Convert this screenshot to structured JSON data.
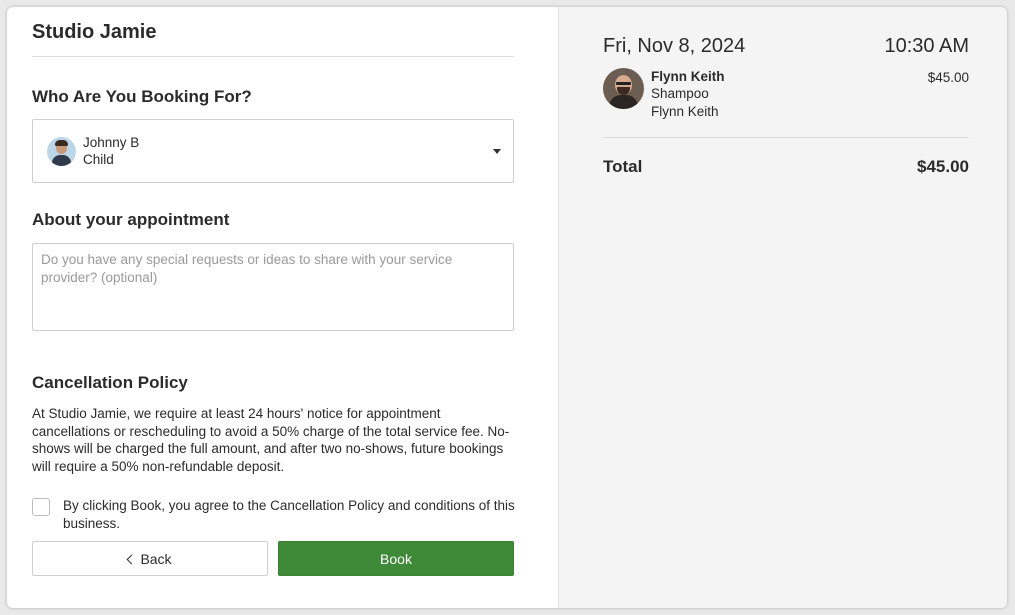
{
  "business": {
    "name": "Studio Jamie"
  },
  "booking_for": {
    "heading": "Who Are You Booking For?",
    "selected_name": "Johnny B",
    "selected_relation": "Child"
  },
  "appointment_notes": {
    "heading": "About your appointment",
    "placeholder": "Do you have any special requests or ideas to share with your service provider? (optional)",
    "value": ""
  },
  "cancellation": {
    "heading": "Cancellation Policy",
    "text": "At Studio Jamie, we require at least 24 hours' notice for appointment cancellations or rescheduling to avoid a 50% charge of the total service fee. No-shows will be charged the full amount, and after two no-shows, future bookings will require a 50% non-refundable deposit.",
    "agree_label": "By clicking Book, you agree to the Cancellation Policy and conditions of this business.",
    "agreed": false
  },
  "actions": {
    "back_label": "Back",
    "book_label": "Book",
    "book_color": "#3f8a38"
  },
  "summary": {
    "date": "Fri, Nov 8, 2024",
    "time": "10:30 AM",
    "provider_name": "Flynn Keith",
    "service": "Shampoo",
    "staff": "Flynn Keith",
    "price": "$45.00",
    "total_label": "Total",
    "total_value": "$45.00"
  }
}
